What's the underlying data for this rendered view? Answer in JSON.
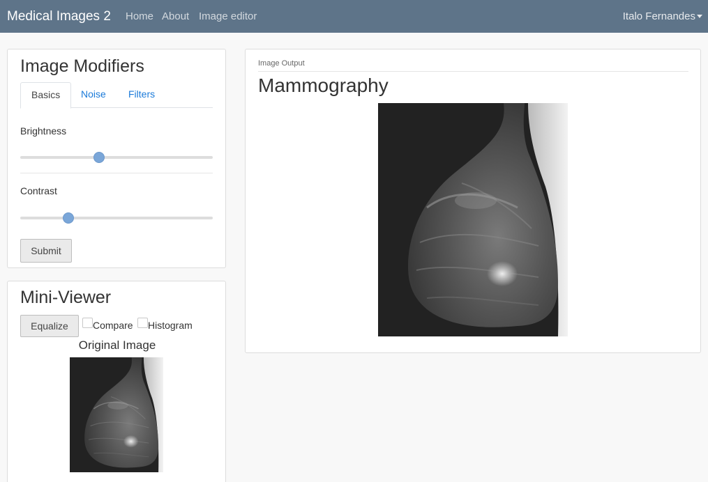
{
  "navbar": {
    "brand": "Medical Images 2",
    "links": [
      "Home",
      "About",
      "Image editor"
    ],
    "user": "Italo Fernandes"
  },
  "modifiers": {
    "title": "Image Modifiers",
    "tabs": [
      "Basics",
      "Noise",
      "Filters"
    ],
    "active_tab": "Basics",
    "brightness": {
      "label": "Brightness",
      "value": 0.41
    },
    "contrast": {
      "label": "Contrast",
      "value": 0.25
    },
    "submit_label": "Submit"
  },
  "mini_viewer": {
    "title": "Mini-Viewer",
    "equalize_label": "Equalize",
    "compare_label": "Compare",
    "compare_checked": false,
    "histogram_label": "Histogram",
    "histogram_checked": false,
    "original_caption": "Original Image"
  },
  "output": {
    "caption": "Image Output",
    "title": "Mammography"
  },
  "colors": {
    "navbar": "#5e7489",
    "link": "#1a7ad9",
    "slider_thumb": "#7aa6d8"
  }
}
